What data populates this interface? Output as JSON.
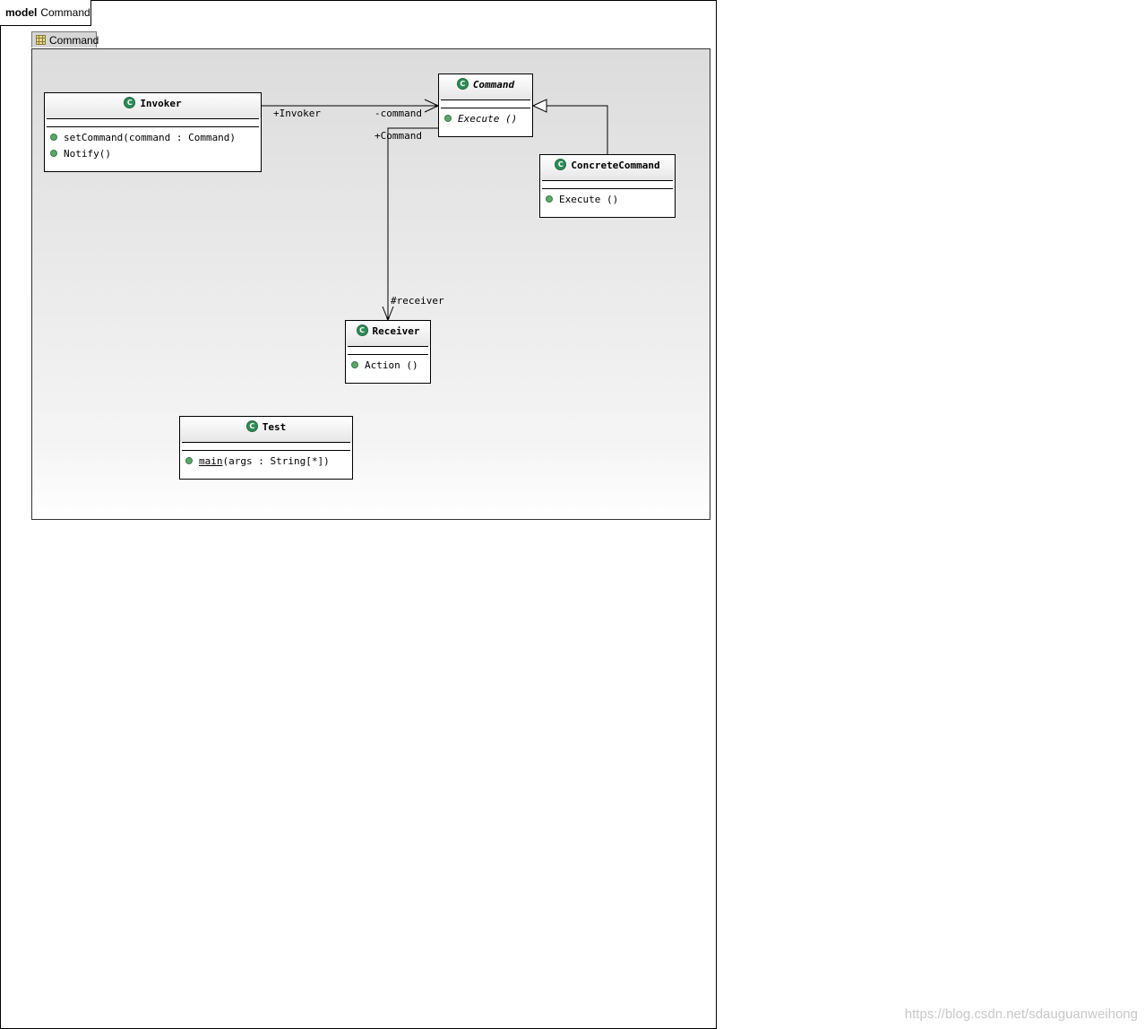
{
  "model": {
    "keyword": "model",
    "name": "Command"
  },
  "package": {
    "name": "Command"
  },
  "classes": {
    "invoker": {
      "name": "Invoker",
      "operations": [
        "setCommand(command : Command)",
        "Notify()"
      ]
    },
    "command": {
      "name": "Command",
      "abstract": true,
      "operations": [
        "Execute ()"
      ]
    },
    "concrete": {
      "name": "ConcreteCommand",
      "operations": [
        "Execute ()"
      ]
    },
    "receiver": {
      "name": "Receiver",
      "operations": [
        "Action ()"
      ]
    },
    "test": {
      "name": "Test",
      "operation_name": "main",
      "operation_rest": "(args : String[*])"
    }
  },
  "associations": {
    "invoker_role": "+Invoker",
    "command_role_from_invoker": "-command",
    "command_role_to_receiver": "+Command",
    "receiver_role": "#receiver"
  },
  "icons": {
    "class_icon": "C",
    "class_icon_color": "#2e8b57",
    "operation_dot_color": "#5aa86a"
  },
  "watermark": "https://blog.csdn.net/sdauguanweihong"
}
